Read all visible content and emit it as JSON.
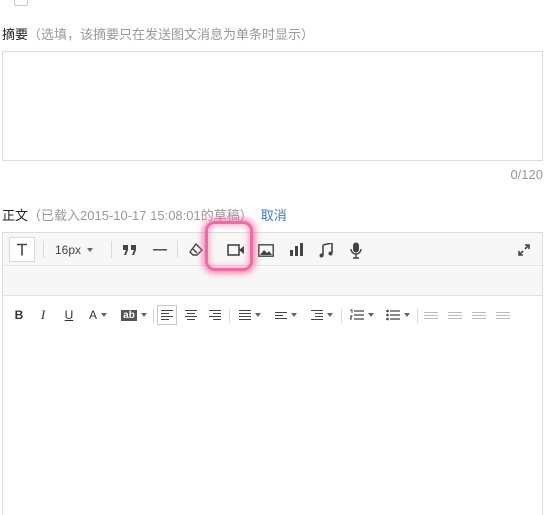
{
  "summary": {
    "label": "摘要",
    "hint": "（选填，该摘要只在发送图文消息为单条时显示）",
    "value": "",
    "counter": "0/120"
  },
  "body": {
    "label": "正文",
    "hint": "（已载入2015-10-17 15:08:01的草稿）",
    "cancel_link": "取消"
  },
  "toolbar": {
    "font_size": "16px",
    "row1_icons": [
      "text-format-icon",
      "blockquote-icon",
      "horizontal-rule-icon",
      "clear-format-icon",
      "video-icon",
      "image-icon",
      "chart-icon",
      "music-icon",
      "microphone-icon",
      "fullscreen-icon"
    ],
    "row2_labels": {
      "bold": "B",
      "italic": "I",
      "underline": "U",
      "font_color": "A",
      "highlight": "ab"
    }
  },
  "colors": {
    "link": "#3c7bc0",
    "highlight_ring": "#f26aa2",
    "border": "#dcdcdc",
    "toolbar_bg": "#f7f7f7"
  }
}
